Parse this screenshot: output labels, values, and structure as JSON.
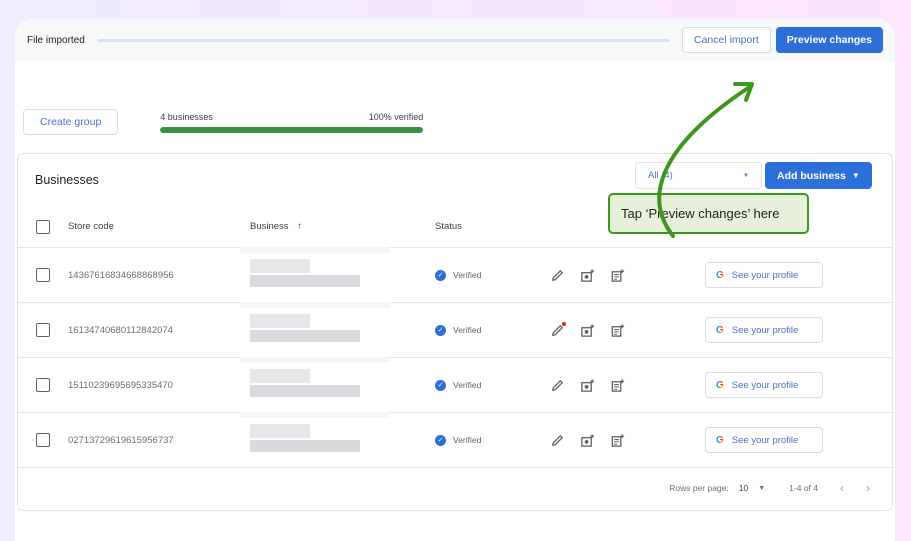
{
  "topbar": {
    "title": "File imported",
    "cancel_label": "Cancel import",
    "preview_label": "Preview changes"
  },
  "summary": {
    "create_group_label": "Create group",
    "count_label": "4 businesses",
    "verified_label": "100% verified",
    "verified_fraction": 1.0
  },
  "businesses": {
    "heading": "Businesses",
    "filter_label": "All (4)",
    "add_business_label": "Add business",
    "columns": {
      "store_code": "Store code",
      "business": "Business",
      "business_sort": "↑",
      "status": "Status"
    },
    "rows": [
      {
        "store_code": "14367616834668868956",
        "status": "Verified",
        "profile_label": "See your profile",
        "edit_alert": false
      },
      {
        "store_code": "16134740680112842074",
        "status": "Verified",
        "profile_label": "See your profile",
        "edit_alert": true
      },
      {
        "store_code": "15110239695695335470",
        "status": "Verified",
        "profile_label": "See your profile",
        "edit_alert": false
      },
      {
        "store_code": "02713729619615956737",
        "status": "Verified",
        "profile_label": "See your profile",
        "edit_alert": false
      }
    ],
    "footer": {
      "rows_per_page_label": "Rows per page:",
      "rows_per_page_value": "10",
      "range_label": "1-4 of 4",
      "prev_icon": "‹",
      "next_icon": "›"
    }
  },
  "tooltip": {
    "text": "Tap ‘Preview changes’ here"
  },
  "colors": {
    "primary": "#2d6fd9",
    "progress": "#3c8c44",
    "annotation": "#3e9620",
    "alert_dot": "#d93025"
  }
}
